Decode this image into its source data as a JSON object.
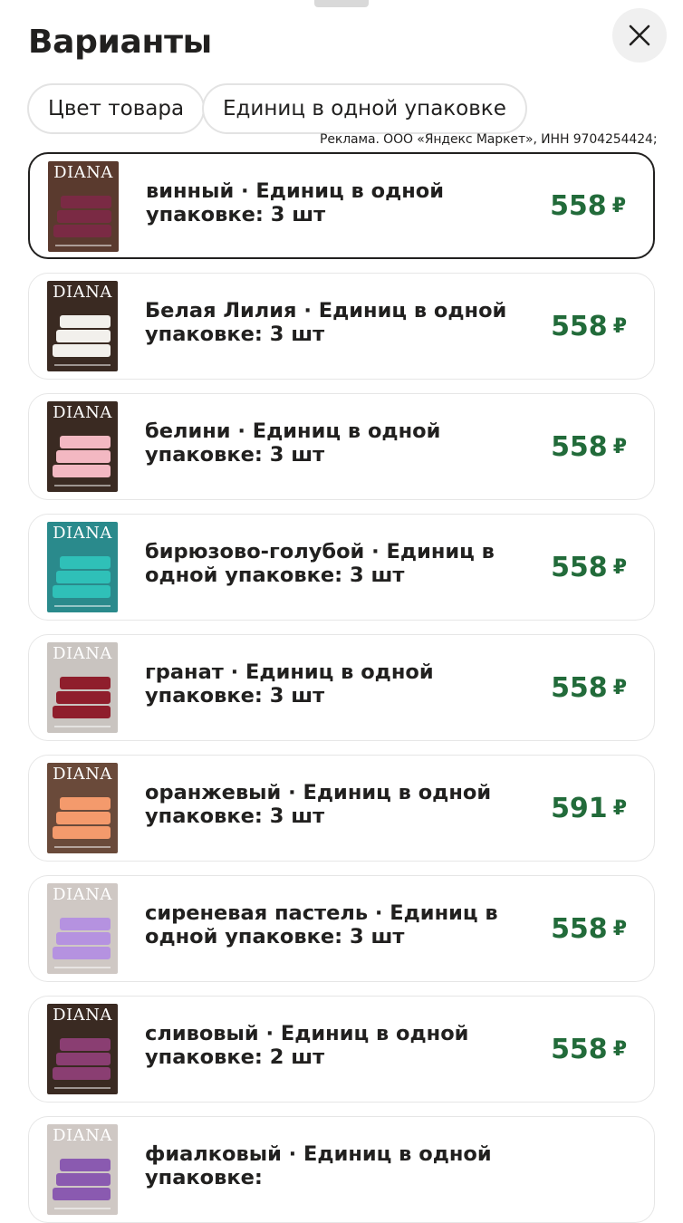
{
  "header": {
    "title": "Варианты",
    "close_icon": "close-icon"
  },
  "filters": [
    {
      "label": "Цвет товара"
    },
    {
      "label": "Единиц в одной упаковке"
    }
  ],
  "ad_note": "Реклама. ООО «Яндекс Маркет», ИНН 9704254424;",
  "currency": "₽",
  "variants": [
    {
      "text": "винный · Единиц в одной упаковке: 3 шт",
      "price": "558",
      "selected": true,
      "thumb": {
        "brand": "DIANA",
        "bg": "#5a3a2e",
        "towel": "#7a2a44"
      }
    },
    {
      "text": "Белая Лилия · Единиц в одной упаковке: 3 шт",
      "price": "558",
      "selected": false,
      "thumb": {
        "brand": "DIANA",
        "bg": "#3a2a22",
        "towel": "#f2f0ec"
      }
    },
    {
      "text": "белини · Единиц в одной упаковке: 3 шт",
      "price": "558",
      "selected": false,
      "thumb": {
        "brand": "DIANA",
        "bg": "#3a2a22",
        "towel": "#f3b8c2"
      }
    },
    {
      "text": "бирюзово-голубой · Единиц в одной упаковке: 3 шт",
      "price": "558",
      "selected": false,
      "thumb": {
        "brand": "DIANA",
        "bg": "#2a8a8c",
        "towel": "#2fc0b8"
      }
    },
    {
      "text": "гранат · Единиц в одной упаковке: 3 шт",
      "price": "558",
      "selected": false,
      "thumb": {
        "brand": "DIANA",
        "bg": "#c9c4c0",
        "towel": "#8f1e2c"
      }
    },
    {
      "text": "оранжевый · Единиц в одной упаковке: 3 шт",
      "price": "591",
      "selected": false,
      "thumb": {
        "brand": "DIANA",
        "bg": "#6a4a3a",
        "towel": "#f49a6c"
      }
    },
    {
      "text": "сиреневая пастель · Единиц в одной упаковке: 3 шт",
      "price": "558",
      "selected": false,
      "thumb": {
        "brand": "DIANA",
        "bg": "#cfc8c4",
        "towel": "#b592e0"
      }
    },
    {
      "text": "сливовый · Единиц в одной упаковке: 2 шт",
      "price": "558",
      "selected": false,
      "thumb": {
        "brand": "DIANA",
        "bg": "#3a2a22",
        "towel": "#8a3e72"
      }
    },
    {
      "text": "фиалковый · Единиц в одной упаковке:",
      "price": "",
      "selected": false,
      "thumb": {
        "brand": "DIANA",
        "bg": "#cfc8c4",
        "towel": "#8a5ab0"
      }
    }
  ]
}
